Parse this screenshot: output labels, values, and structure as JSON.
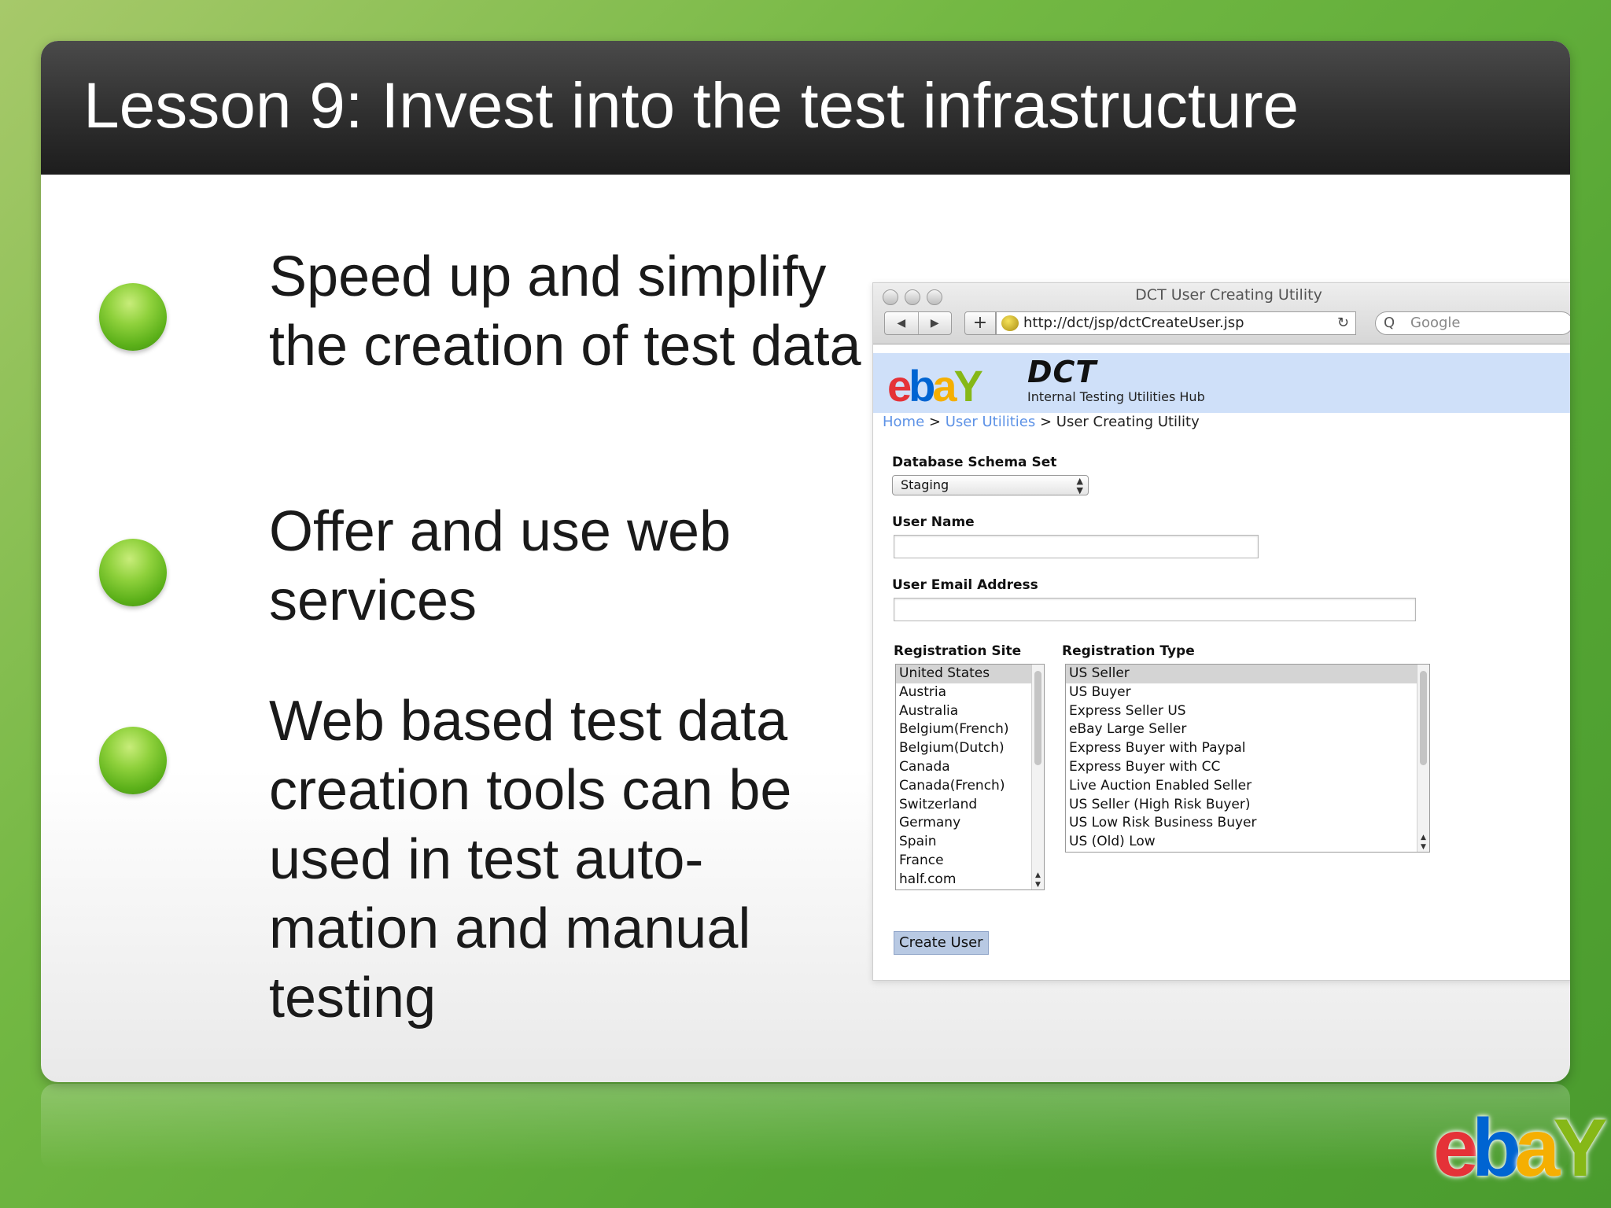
{
  "slide": {
    "title": "Lesson 9: Invest into the test infrastructure",
    "bullets": [
      "Speed up and simplify the creation of test data",
      "Offer and use web services",
      "Web based test data creation tools can be used in test auto-mation and manual testing"
    ],
    "logo": {
      "e": "e",
      "b": "b",
      "a": "a",
      "y": "Y"
    }
  },
  "browser": {
    "window_title": "DCT User Creating Utility",
    "back_icon": "◀",
    "forward_icon": "▶",
    "add_icon": "+",
    "url": "http://dct/jsp/dctCreateUser.jsp",
    "reload_icon": "↻",
    "search_placeholder": "Google",
    "search_icon": "Q",
    "hub": {
      "logo": {
        "e": "e",
        "b": "b",
        "a": "a",
        "y": "Y"
      },
      "name": "DCT",
      "subtitle": "Internal Testing Utilities Hub"
    },
    "breadcrumb": {
      "home": "Home",
      "sep1": ">",
      "user_utilities": "User Utilities",
      "sep2": ">",
      "current": "User Creating Utility"
    },
    "form": {
      "schema_label": "Database Schema Set",
      "schema_value": "Staging",
      "username_label": "User Name",
      "username_value": "",
      "email_label": "User Email Address",
      "email_value": "",
      "site_label": "Registration Site",
      "sites": [
        "United States",
        "Austria",
        "Australia",
        "Belgium(French)",
        "Belgium(Dutch)",
        "Canada",
        "Canada(French)",
        "Switzerland",
        "Germany",
        "Spain",
        "France",
        "half.com"
      ],
      "site_selected": "United States",
      "type_label": "Registration Type",
      "types": [
        "US Seller",
        "US Buyer",
        "Express Seller US",
        "eBay Large Seller",
        "Express Buyer with Paypal",
        "Express Buyer with CC",
        "Live Auction Enabled Seller",
        "US Seller (High Risk Buyer)",
        "US Low Risk Business Buyer",
        "US (Old) Low"
      ],
      "type_selected": "US Seller",
      "submit_label": "Create User"
    }
  },
  "colors": {
    "bullet": "#6cc024",
    "title_bar": "#2f2f2f",
    "banner": "#cfe0f9",
    "link": "#5d92e6",
    "button": "#b8c9e3"
  }
}
